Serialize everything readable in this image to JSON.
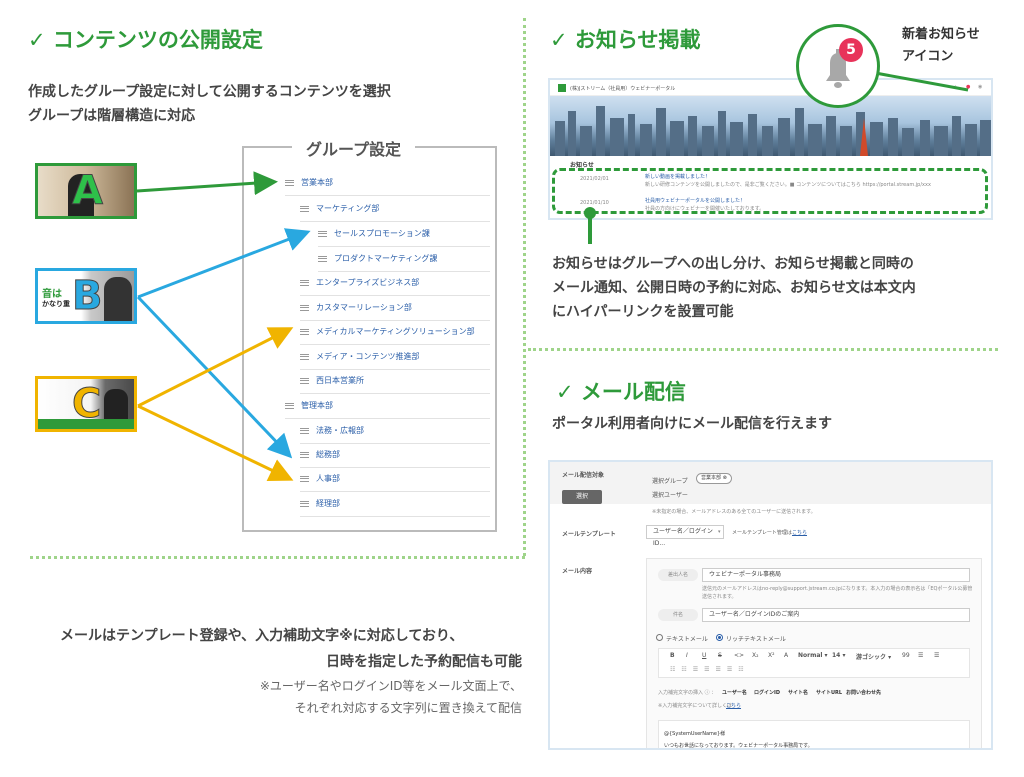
{
  "left": {
    "title": "✓ コンテンツの公開設定",
    "desc_line1": "作成したグループ設定に対して公開するコンテンツを選択",
    "desc_line2": "グループは階層構造に対応",
    "thumbs": [
      {
        "letter": "A",
        "color": "#2e9a3a"
      },
      {
        "letter": "B",
        "color": "#29a8e0",
        "caption1": "音は",
        "caption2": "かなり重"
      },
      {
        "letter": "C",
        "color": "#f0b400"
      }
    ],
    "group_title": "グループ設定",
    "groups": [
      "営業本部",
      "マーケティング部",
      "セールスプロモーション課",
      "プロダクトマーケティング課",
      "エンタープライズビジネス部",
      "カスタマーリレーション部",
      "メディカルマーケティングソリューション部",
      "メディア・コンテンツ推進部",
      "西日本営業所",
      "管理本部",
      "法務・広報部",
      "総務部",
      "人事部",
      "経理部"
    ],
    "bottom_line1": "メールはテンプレート登録や、入力補助文字※に対応しており、",
    "bottom_line2": "日時を指定した予約配信も可能",
    "note_line1": "※ユーザー名やログインID等をメール文面上で、",
    "note_line2": "それぞれ対応する文字列に置き換えて配信"
  },
  "notice": {
    "title": "✓ お知らせ掲載",
    "bell_label1": "新着お知らせ",
    "bell_label2": "アイコン",
    "badge": "5",
    "portal_name": "(株)Jストリーム（社員用）ウェビナーポータル",
    "news_heading": "お知らせ",
    "news": [
      {
        "date": "2021/02/01",
        "title": "新しい動画を掲載しました！",
        "body": "新しい研修コンテンツを公開しましたので、是非ご覧ください。■ コンテンツについてはこちら https://portal.stream.jp/xxx"
      },
      {
        "date": "2021/01/10",
        "title": "社員用ウェビナーポータルを公開しました！",
        "body": "社員の方向けにウェビナーを開催いたしております。"
      }
    ],
    "desc_line1": "お知らせはグループへの出し分け、お知らせ掲載と同時の",
    "desc_line2": "メール通知、公開日時の予約に対応、お知らせ文は本文内",
    "desc_line3": "にハイパーリンクを設置可能"
  },
  "mail": {
    "title": "✓ メール配信",
    "desc": "ポータル利用者向けにメール配信を行えます",
    "target_label": "メール配信対象",
    "select_btn": "選択",
    "selected_group_label": "選択グループ",
    "selected_group_tag": "営業本部 ⊗",
    "selected_user_label": "選択ユーザー",
    "target_note": "※未指定の場合、メールアドレスのある全てのユーザーに送信されます。",
    "template_label": "メールテンプレート",
    "template_value": "ユーザー名／ログインID...",
    "template_link_prefix": "メールテンプレート管理は",
    "template_link": "こちら",
    "content_label": "メール内容",
    "sender_label": "差出人名",
    "sender_value": "ウェビナーポータル事務局",
    "sender_note1": "送信元のメールアドレスはno-reply@support.jstream.co.jpになります。本入力の場合の表示名は「EQポータル公募管理システム」で",
    "sender_note2": "送信されます。",
    "subject_label": "件名",
    "subject_value": "ユーザー名／ログインIDのご案内",
    "radio_text": "テキストメール",
    "radio_rich": "リッチテキストメール",
    "toolbar_items": [
      "B",
      "I",
      "U",
      "S",
      "<>",
      "X₂",
      "X²",
      "A",
      "Normal ▾",
      "14 ▾",
      "游ゴシック ▾",
      "99",
      "☰",
      "☰"
    ],
    "assist_label": "入力補完文字の挿入 ⓘ ：",
    "assist_items": [
      "ユーザー名",
      "ログインID",
      "サイト名",
      "サイトURL",
      "お問い合わせ先"
    ],
    "assist_link_prefix": "※入力補完文字について詳しくは",
    "assist_link": "こちら",
    "body_preview": "@{SystemUserName}様",
    "body_preview2": "いつもお世話になっております。ウェビナーポータル事務局です。"
  }
}
